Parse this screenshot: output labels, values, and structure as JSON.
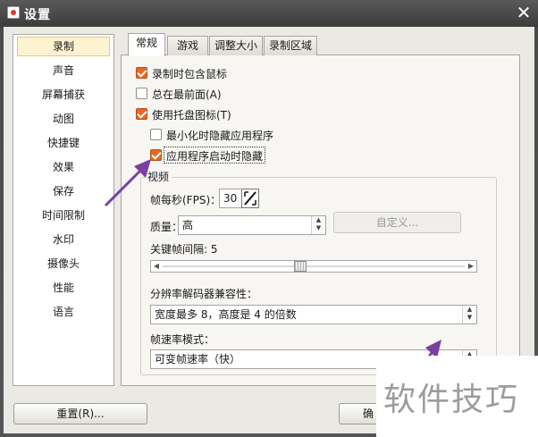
{
  "window": {
    "title": "设置",
    "close": "✕"
  },
  "nav": {
    "items": [
      {
        "label": "录制",
        "selected": true
      },
      {
        "label": "声音"
      },
      {
        "label": "屏幕捕获"
      },
      {
        "label": "动图"
      },
      {
        "label": "快捷键"
      },
      {
        "label": "效果"
      },
      {
        "label": "保存"
      },
      {
        "label": "时间限制"
      },
      {
        "label": "水印"
      },
      {
        "label": "摄像头"
      },
      {
        "label": "性能"
      },
      {
        "label": "语言"
      }
    ]
  },
  "tabs": [
    {
      "label": "常规",
      "active": true
    },
    {
      "label": "游戏"
    },
    {
      "label": "调整大小"
    },
    {
      "label": "录制区域"
    }
  ],
  "options": [
    {
      "label": "录制时包含鼠标",
      "checked": true
    },
    {
      "label": "总在最前面(A)",
      "checked": false
    },
    {
      "label": "使用托盘图标(T)",
      "checked": true
    },
    {
      "label": "最小化时隐藏应用程序",
      "checked": false
    },
    {
      "label": "应用程序启动时隐藏",
      "checked": true
    }
  ],
  "video": {
    "group_title": "视频",
    "fps_label": "帧每秒(FPS)：",
    "fps_value": "30",
    "quality_label": "质量：",
    "quality_value": "高",
    "custom_button": "自定义...",
    "keyframe_label": "关键帧间隔: 5",
    "keyframe_interval": 5,
    "resolution_label": "分辨率解码器兼容性：",
    "resolution_value": "宽度最多 8，高度是 4 的倍数",
    "framerate_mode_label": "帧速率模式：",
    "framerate_mode_value": "可变帧速率（快）"
  },
  "footer": {
    "reset_button": "重置(R)...",
    "ok_button": "确"
  },
  "watermark": "软件技巧",
  "colors": {
    "check_accent": "#e46a24",
    "annotation_arrow": "#7b3fa0",
    "selected_nav": "#fdf3d0"
  }
}
